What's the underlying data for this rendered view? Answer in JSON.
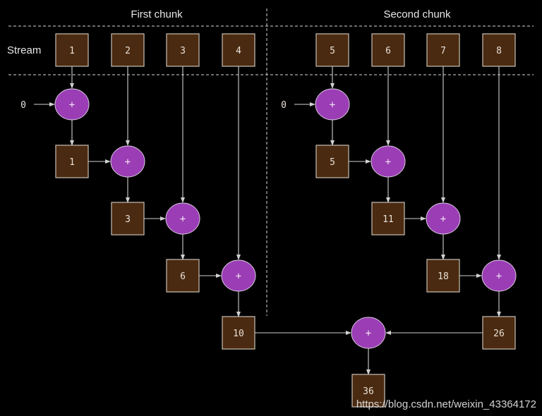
{
  "headers": {
    "first": "First chunk",
    "second": "Second chunk"
  },
  "row_label": "Stream",
  "stream": [
    "1",
    "2",
    "3",
    "4",
    "5",
    "6",
    "7",
    "8"
  ],
  "initial": {
    "first": "0",
    "second": "0"
  },
  "operator": "+",
  "first_chunk_partials": [
    "1",
    "3",
    "6",
    "10"
  ],
  "second_chunk_partials": [
    "5",
    "11",
    "18",
    "26"
  ],
  "final_result": "36",
  "watermark": "https://blog.csdn.net/weixin_43364172",
  "colors": {
    "box": "#4a2a10",
    "operator": "#9b3db5",
    "background": "#000000"
  }
}
